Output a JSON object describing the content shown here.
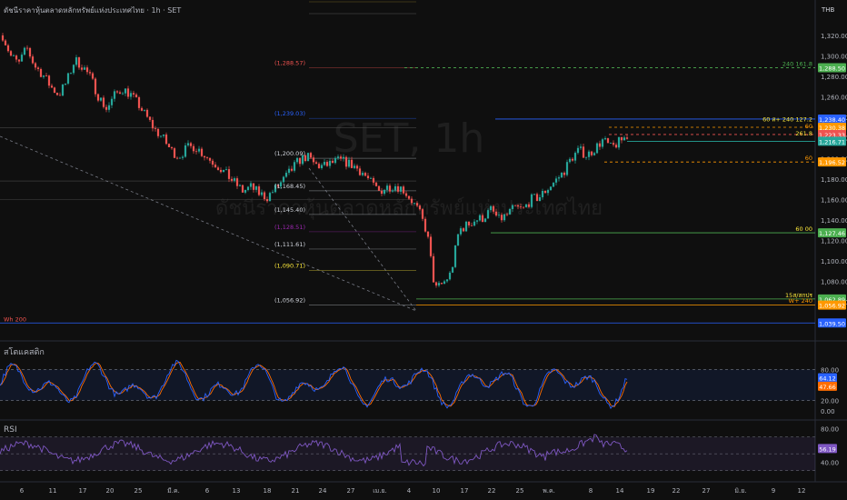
{
  "header": {
    "title": "ดัชนีราคาหุ้นตลาดหลักทรัพย์แห่งประเทศไทย · 1h · SET",
    "currency": "THB"
  },
  "watermark": {
    "symbol": "SET, 1h",
    "name": "ดัชนีราคาหุ้นตลาดหลักทรัพย์แห่งประเทศไทย"
  },
  "panes": {
    "stoch_label": "สโตแคสติก",
    "rsi_label": "RSI"
  },
  "colors": {
    "background": "#0f0f0f",
    "up": "#26a69a",
    "down": "#ef5350",
    "stoch_k": "#2962ff",
    "stoch_d": "#ff6d00",
    "rsi": "#7e57c2",
    "fib_blue": "#2962ff",
    "green_level": "#4caf50",
    "orange_level": "#ff9800"
  },
  "chart_data": [
    {
      "type": "candlestick",
      "title": "SET, 1h",
      "ylim": [
        1030,
        1335
      ],
      "y_ticks": [
        "1,320.00",
        "1,300.00",
        "1,280.00",
        "1,260.00",
        "1,240.00",
        "1,220.00",
        "1,200.00",
        "1,180.00",
        "1,160.00",
        "1,140.00",
        "1,120.00",
        "1,100.00",
        "1,080.00",
        "1,060.00"
      ],
      "x_tick_labels": [
        "6",
        "11",
        "17",
        "20",
        "25",
        "มี.ค.",
        "6",
        "13",
        "18",
        "21",
        "24",
        "27",
        "เม.ย.",
        "4",
        "10",
        "17",
        "22",
        "25",
        "พ.ค.",
        "8",
        "14",
        "19",
        "22",
        "27",
        "มิ.ย.",
        "9",
        "12"
      ],
      "path_points": [
        1320,
        1300,
        1292,
        1308,
        1290,
        1282,
        1270,
        1262,
        1275,
        1296,
        1290,
        1278,
        1260,
        1248,
        1262,
        1268,
        1262,
        1252,
        1240,
        1228,
        1220,
        1208,
        1202,
        1210,
        1212,
        1205,
        1198,
        1192,
        1184,
        1176,
        1168,
        1172,
        1166,
        1162,
        1170,
        1178,
        1188,
        1198,
        1202,
        1194,
        1192,
        1195,
        1198,
        1196,
        1192,
        1186,
        1176,
        1168,
        1172,
        1174,
        1170,
        1160,
        1148,
        1128,
        1072,
        1078,
        1088,
        1130,
        1135,
        1140,
        1142,
        1150,
        1140,
        1145,
        1152,
        1150,
        1160,
        1162,
        1170,
        1178,
        1186,
        1200,
        1208,
        1203,
        1210,
        1218,
        1210,
        1216,
        1222
      ],
      "fib_labels": [
        {
          "price": 1288.57,
          "text": "(1,288.57)",
          "color": "#ef5350"
        },
        {
          "price": 1239.03,
          "text": "(1,239.03)",
          "color": "#2962ff"
        },
        {
          "price": 1200.09,
          "text": "(1,200.09)",
          "color": "#d1d4dc"
        },
        {
          "price": 1168.45,
          "text": "(1,168.45)",
          "color": "#d1d4dc"
        },
        {
          "price": 1145.4,
          "text": "(1,145.40)",
          "color": "#d1d4dc"
        },
        {
          "price": 1128.51,
          "text": "(1,128.51)",
          "color": "#9c27b0"
        },
        {
          "price": 1111.61,
          "text": "(1,111.61)",
          "color": "#d1d4dc"
        },
        {
          "price": 1090.71,
          "text": "(1,090.71)",
          "color": "#ffeb3b"
        },
        {
          "price": 1056.92,
          "text": "(1,056.92)",
          "color": "#d1d4dc"
        }
      ],
      "level_labels": [
        {
          "price": 1288.5,
          "text": "240 161.8",
          "color": "#4caf50"
        },
        {
          "price": 1234.5,
          "text": "60 ส+ 240 127.2",
          "color": "#ffeb3b"
        },
        {
          "price": 1227.5,
          "text": "60",
          "color": "#ff9800"
        },
        {
          "price": 1220.5,
          "text": "261.8",
          "color": "#ffeb3b"
        },
        {
          "price": 1196.52,
          "text": "60",
          "color": "#ff9800"
        },
        {
          "price": 1127.46,
          "text": "60 00",
          "color": "#ffeb3b"
        },
        {
          "price": 1062.89,
          "text": "15ส/สกปร",
          "color": "#ffeb3b"
        },
        {
          "price": 1057.5,
          "text": "W+ 240",
          "color": "#ff9800"
        },
        {
          "price": 1039.5,
          "text": "Wh 200",
          "color": "#ef5350"
        }
      ],
      "price_badges": [
        {
          "price": 1288.5,
          "text": "1,288.50",
          "color": "#4caf50"
        },
        {
          "price": 1238.4,
          "text": "1,238.40",
          "color": "#2962ff"
        },
        {
          "price": 1230.38,
          "text": "1,230.38",
          "color": "#ff9800"
        },
        {
          "price": 1223.33,
          "text": "1,223.33",
          "color": "#ef5350"
        },
        {
          "price": 1216.71,
          "text": "1,216.71",
          "color": "#26a69a"
        },
        {
          "price": 1196.52,
          "text": "1,196.52",
          "color": "#ff9800"
        },
        {
          "price": 1127.46,
          "text": "1,127.46",
          "color": "#4caf50"
        },
        {
          "price": 1062.89,
          "text": "1,062.89",
          "color": "#4caf50"
        },
        {
          "price": 1056.92,
          "text": "1,056.92",
          "color": "#ff9800"
        },
        {
          "price": 1039.5,
          "text": "1,039.50",
          "color": "#2962ff"
        }
      ]
    },
    {
      "type": "line",
      "title": "สโตแคสติก",
      "ylim": [
        0,
        100
      ],
      "y_ticks": [
        "80.00",
        "20.00",
        "0.00"
      ],
      "band": [
        20,
        80
      ],
      "series": [
        {
          "value_label": "64.12",
          "color": "#2962ff"
        },
        {
          "value_label": "47.66",
          "color": "#ff6d00"
        }
      ]
    },
    {
      "type": "line",
      "title": "RSI",
      "ylim": [
        20,
        90
      ],
      "y_ticks": [
        "80.00",
        "40.00"
      ],
      "band": [
        30,
        70
      ],
      "series": [
        {
          "value_label": "56.19",
          "color": "#7e57c2"
        }
      ]
    }
  ]
}
